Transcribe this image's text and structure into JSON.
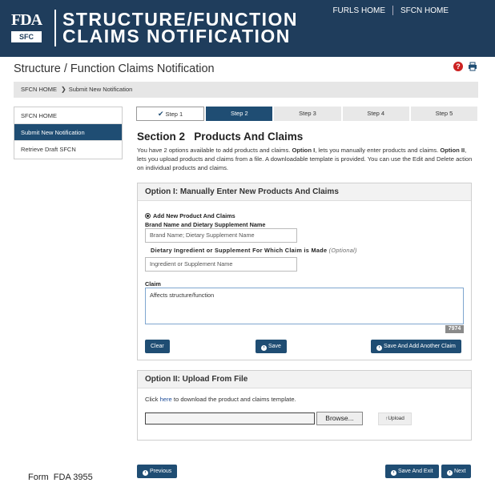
{
  "header": {
    "logo_main": "FDA",
    "logo_sub": "SFC",
    "title_line1": "STRUCTURE/FUNCTION",
    "title_line2": "CLAIMS NOTIFICATION",
    "links": [
      "FURLS HOME",
      "SFCN HOME"
    ]
  },
  "page": {
    "title": "Structure / Function Claims Notification",
    "breadcrumb": [
      "SFCN HOME",
      "Submit New Notification"
    ]
  },
  "sidebar": {
    "items": [
      {
        "label": "SFCN HOME"
      },
      {
        "label": "Submit New Notification"
      },
      {
        "label": "Retrieve Draft SFCN"
      }
    ]
  },
  "steps": [
    "Step 1",
    "Step 2",
    "Step 3",
    "Step 4",
    "Step 5"
  ],
  "section": {
    "title": "Section 2   Products And Claims",
    "desc_a": "You have 2 options available to add products and claims. ",
    "desc_b": "Option I",
    "desc_c": ", lets you manually enter products and claims. ",
    "desc_d": "Option II",
    "desc_e": ", lets you upload products and claims from a file. A downloadable template is provided. You can use the Edit and Delete action on individual products and claims."
  },
  "option1": {
    "heading": "Option I: Manually Enter New Products And Claims",
    "radio_label": "Add New Product And Claims",
    "brand_label": "Brand Name and Dietary Supplement Name",
    "brand_placeholder": "Brand Name; Dietary Supplement Name",
    "ingredient_label": "Dietary Ingredient or Supplement For Which Claim is Made",
    "ingredient_optional": "(Optional)",
    "ingredient_placeholder": "Ingredient or Supplement Name",
    "claim_label": "Claim",
    "claim_value": "Affects structure/function",
    "counter": "7974",
    "clear_label": "Clear",
    "save_label": "Save",
    "save_another_label": "Save And Add Another Claim"
  },
  "option2": {
    "heading": "Option II: Upload From File",
    "text_before": "Click ",
    "link": "here",
    "text_after": " to download the product and claims template.",
    "browse_label": "Browse...",
    "upload_label": "Upload"
  },
  "footer": {
    "previous_label": "Previous",
    "save_exit_label": "Save And Exit",
    "next_label": "Next",
    "form_label": "Form  FDA 3955"
  }
}
